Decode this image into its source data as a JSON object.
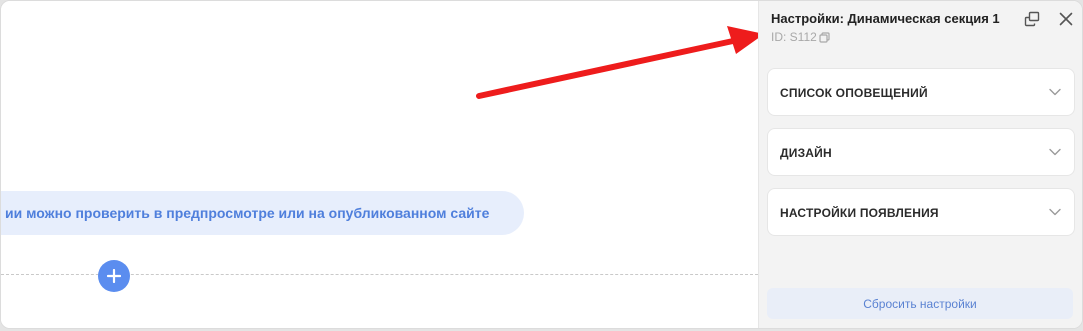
{
  "canvas": {
    "info_text": "ии можно проверить в предпросмотре или на опубликованном сайте",
    "add_button_icon": "plus-icon"
  },
  "panel": {
    "title": "Настройки: Динамическая секция 1",
    "id_text": "ID: S112",
    "sections": [
      {
        "label": "СПИСОК ОПОВЕЩЕНИЙ"
      },
      {
        "label": "ДИЗАЙН"
      },
      {
        "label": "НАСТРОЙКИ ПОЯВЛЕНИЯ"
      }
    ],
    "reset_label": "Сбросить настройки"
  },
  "colors": {
    "accent": "#5b8def",
    "annotation_arrow": "#ee1c1c",
    "info_bg": "#e7eefc",
    "info_text": "#4f7fdc"
  }
}
